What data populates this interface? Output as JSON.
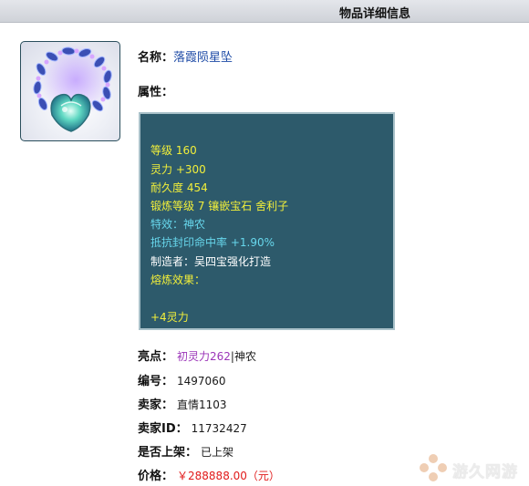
{
  "header": {
    "title": "物品详细信息"
  },
  "item": {
    "name_label": "名称：",
    "name_value": "落霞陨星坠",
    "attributes_label": "属性：",
    "attributes": [
      {
        "text": "等级 160",
        "color": "#f2ef3a"
      },
      {
        "text": "灵力 +300",
        "color": "#f2ef3a"
      },
      {
        "text": "耐久度 454",
        "color": "#f2ef3a"
      },
      {
        "text": "锻炼等级 7 镶嵌宝石 舍利子",
        "color": "#f2ef3a"
      },
      {
        "text": "特效：神农",
        "color": "#67d7ec"
      },
      {
        "text": "抵抗封印命中率 +1.90%",
        "color": "#67d7ec"
      },
      {
        "text": "制造者：吴四宝强化打造",
        "color": "#ffffff"
      },
      {
        "text": "熔炼效果：",
        "color": "#f2ef3a"
      },
      {
        "text": "+4灵力",
        "color": "#f2ef3a"
      }
    ]
  },
  "info": {
    "highlight_label": "亮点：",
    "highlight_value": "初灵力262",
    "highlight_sep": "|",
    "highlight_extra": "神农",
    "id_label": "编号：",
    "id_value": "1497060",
    "seller_label": "卖家：",
    "seller_value": "直情1103",
    "seller_id_label": "卖家ID：",
    "seller_id_value": "11732427",
    "listed_label": "是否上架：",
    "listed_value": "已上架",
    "price_label": "价格：",
    "price_value": "￥288888.00（元）"
  },
  "watermark": {
    "text": "游久网游"
  }
}
